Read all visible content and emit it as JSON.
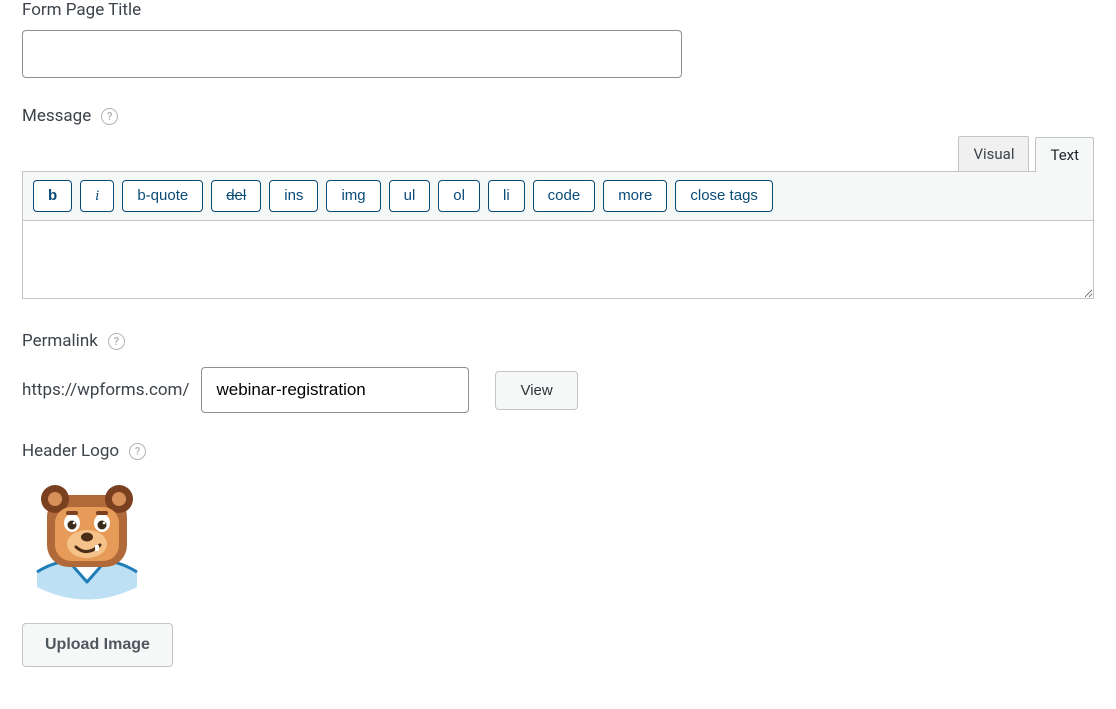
{
  "title_field": {
    "label": "Form Page Title",
    "value": ""
  },
  "message": {
    "label": "Message",
    "tabs": {
      "visual": "Visual",
      "text": "Text"
    },
    "active_tab": "text",
    "quicktags": [
      "b",
      "i",
      "b-quote",
      "del",
      "ins",
      "img",
      "ul",
      "ol",
      "li",
      "code",
      "more",
      "close tags"
    ],
    "content": ""
  },
  "permalink": {
    "label": "Permalink",
    "url_prefix": "https://wpforms.com/",
    "slug": "webinar-registration",
    "view_label": "View"
  },
  "header_logo": {
    "label": "Header Logo",
    "upload_label": "Upload Image"
  }
}
